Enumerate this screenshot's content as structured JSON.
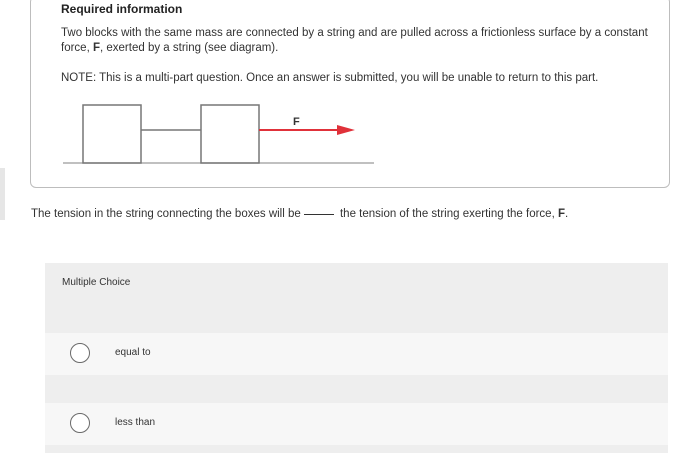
{
  "info": {
    "title": "Required information",
    "line1_pre": "Two blocks with the same mass are connected by a string and are pulled across a frictionless surface by a constant force, ",
    "force_symbol": "F",
    "line1_post": ", exerted by a string (see diagram).",
    "note": "NOTE: This is a multi-part question. Once an answer is submitted, you will be unable to return to this part."
  },
  "diagram": {
    "force_label": "F",
    "arrow_color": "#e0313a"
  },
  "question": {
    "text_pre": "The tension in the string connecting the boxes will be",
    "text_post": " the tension of the string exerting the force, ",
    "force_symbol": "F",
    "end": "."
  },
  "multiple_choice": {
    "label": "Multiple Choice",
    "options": [
      {
        "label": "equal to"
      },
      {
        "label": "less than"
      }
    ]
  }
}
